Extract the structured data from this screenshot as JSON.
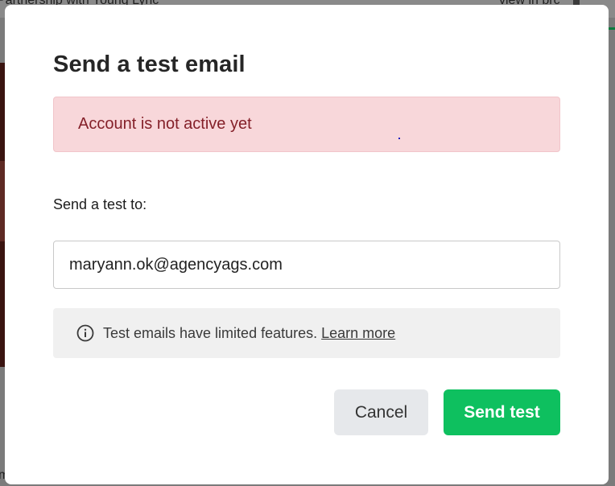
{
  "background": {
    "title": "Partnership with Young Lyric",
    "link": "view in brc",
    "bottom_text": "m"
  },
  "modal": {
    "title": "Send a test email",
    "alert": {
      "text": "Account is not active yet"
    },
    "recipient": {
      "label": "Send a test to:",
      "value": "maryann.ok@agencyags.com"
    },
    "info": {
      "icon": "info-circle-icon",
      "text": "Test emails have limited features.",
      "link": "Learn more"
    },
    "actions": {
      "cancel_label": "Cancel",
      "send_label": "Send test"
    }
  },
  "colors": {
    "alert_bg": "#f8d7da",
    "alert_text": "#842029",
    "primary": "#0ec05f",
    "secondary": "#e6e8eb",
    "info_bg": "#f0f0f0"
  }
}
